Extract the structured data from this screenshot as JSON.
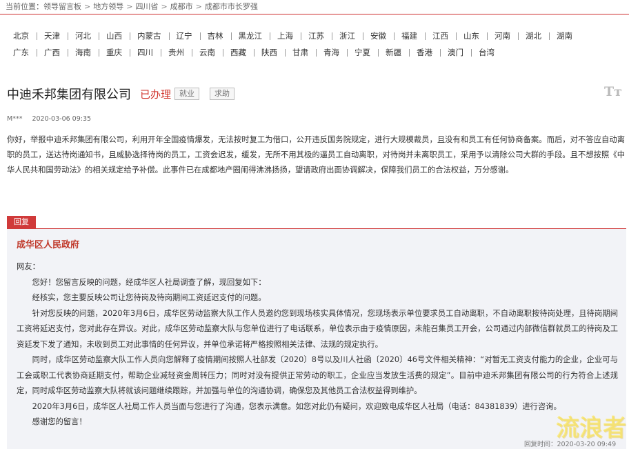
{
  "breadcrumb": {
    "prefix": "当前位置：",
    "items": [
      "领导留言板",
      "地方领导",
      "四川省",
      "成都市",
      "成都市市长罗强"
    ],
    "separator": ">"
  },
  "regions": {
    "row1": [
      "北京",
      "天津",
      "河北",
      "山西",
      "内蒙古",
      "辽宁",
      "吉林",
      "黑龙江",
      "上海",
      "江苏",
      "浙江",
      "安徽",
      "福建",
      "江西",
      "山东",
      "河南",
      "湖北",
      "湖南"
    ],
    "row2": [
      "广东",
      "广西",
      "海南",
      "重庆",
      "四川",
      "贵州",
      "云南",
      "西藏",
      "陕西",
      "甘肃",
      "青海",
      "宁夏",
      "新疆",
      "香港",
      "澳门",
      "台湾"
    ]
  },
  "message": {
    "title": "中迪禾邦集团有限公司",
    "status": "已办理",
    "tags": [
      "就业",
      "求助"
    ],
    "font_toggle": "Tт",
    "author": "M***",
    "date": "2020-03-06 09:35",
    "content": "你好，举报中迪禾邦集团有限公司，利用开年全国疫情爆发，无法按时复工为借口，公开违反国务院规定，进行大规模裁员，且没有和员工有任何协商备案。而后，对不答应自动离职的员工，送达待岗通知书，且威胁选择待岗的员工，工资会迟发，缓发，无所不用其极的逼员工自动离职，对待岗并未离职员工，采用予以清除公司大群的手段。且不想按照《中华人民共和国劳动法》的相关规定给予补偿。此事件已在成都地产圈闹得沸沸扬扬，望请政府出面协调解决，保障我们员工的合法权益，万分感谢。"
  },
  "reply": {
    "tag": "回复",
    "org": "成华区人民政府",
    "greeting": "网友：",
    "paragraphs": [
      "您好！您留言反映的问题，经成华区人社局调查了解，现回复如下：",
      "经核实，您主要反映公司让您待岗及待岗期间工资延迟支付的问题。",
      "针对您反映的问题，2020年3月6日，成华区劳动监察大队工作人员邀约您到现场核实具体情况，您现场表示单位要求员工自动离职，不自动离职按待岗处理，且待岗期间工资将延迟支付，您对此存在异议。对此，成华区劳动监察大队与您单位进行了电话联系，单位表示由于疫情原因，未能召集员工开会，公司通过内部微信群就员工的待岗及工资延发下发了通知，未收到员工对此事情的任何异议，并单位承诺将严格按照相关法律、法规的规定执行。",
      "同时，成华区劳动监察大队工作人员向您解释了疫情期间按照人社部发〔2020〕8号以及川人社函〔2020〕46号文件相关精神：“对暂无工资支付能力的企业，企业可与工会或职工代表协商延期支付，帮助企业减轻资金周转压力；同时对没有提供正常劳动的职工，企业应当发放生活费的规定”。目前中迪禾邦集团有限公司的行为符合上述规定，同时成华区劳动监察大队将就该问题继续跟踪，并加强与单位的沟通协调，确保您及其他员工合法权益得到维护。",
      "2020年3月6日，成华区人社局工作人员当面与您进行了沟通，您表示满意。如您对此仍有疑问，欢迎致电成华区人社局（电话：84381839）进行咨询。",
      "感谢您的留言！"
    ],
    "time_label": "回复时间：",
    "time": "2020-03-20 09:49"
  },
  "watermark": "流浪者"
}
